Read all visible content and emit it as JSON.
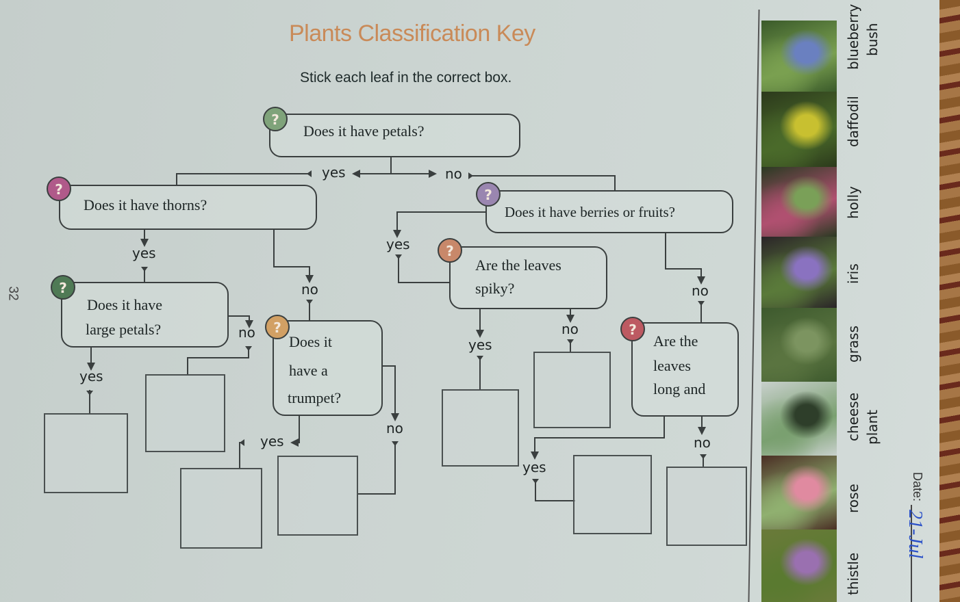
{
  "worksheet": {
    "title": "Plants Classification Key",
    "instruction": "Stick each leaf in the correct box.",
    "page_number": "32",
    "date_label": "Date:",
    "date_value": "21-Jul"
  },
  "colors": {
    "title": "#c98a58",
    "q1_petals": "#7fa37a",
    "q2_thorns": "#b05a8a",
    "q3_large_petals": "#4f7a55",
    "q4_trumpet": "#d2a064",
    "q5_berries": "#9a86b0",
    "q6_spiky": "#c8886a",
    "q7_long": "#bd5a62",
    "date_ink": "#2a50c8"
  },
  "questions": {
    "q1": {
      "mark": "?",
      "text": "Does it have petals?"
    },
    "q2": {
      "mark": "?",
      "text": "Does it have thorns?"
    },
    "q3": {
      "mark": "?",
      "line1": "Does it have",
      "line2": "large petals?"
    },
    "q4": {
      "mark": "?",
      "line1": "Does it",
      "line2": "have a",
      "line3": "trumpet?"
    },
    "q5": {
      "mark": "?",
      "text": "Does it have berries or fruits?"
    },
    "q6": {
      "mark": "?",
      "line1": "Are the leaves",
      "line2": "spiky?"
    },
    "q7": {
      "mark": "?",
      "line1": "Are the",
      "line2": "leaves",
      "line3": "long and"
    }
  },
  "branch_labels": {
    "q1_yes": "yes",
    "q1_no": "no",
    "q2_yes": "yes",
    "q2_no": "no",
    "q3_yes": "yes",
    "q3_no": "no",
    "q4_yes": "yes",
    "q4_no": "no",
    "q5_yes": "yes",
    "q5_no": "no",
    "q6_yes": "yes",
    "q6_no": "no",
    "q7_yes": "yes",
    "q7_no": "no"
  },
  "answer_boxes": [
    {
      "id": "large-petals-yes"
    },
    {
      "id": "large-petals-no"
    },
    {
      "id": "trumpet-yes"
    },
    {
      "id": "trumpet-no"
    },
    {
      "id": "spiky-yes"
    },
    {
      "id": "spiky-no"
    },
    {
      "id": "long-yes"
    },
    {
      "id": "long-no"
    }
  ],
  "plants": [
    {
      "name": "blueberry",
      "name2": "bush",
      "photo_colors": [
        "#3a5a2a",
        "#6a80c0",
        "#7aa050"
      ]
    },
    {
      "name": "daffodil",
      "photo_colors": [
        "#2c3a1c",
        "#c8c030",
        "#4a6a2a"
      ]
    },
    {
      "name": "holly",
      "photo_colors": [
        "#2a3a22",
        "#7aa058",
        "#b05070"
      ]
    },
    {
      "name": "iris",
      "photo_colors": [
        "#2a2428",
        "#8a72c0",
        "#5a7a3a"
      ]
    },
    {
      "name": "grass",
      "photo_colors": [
        "#3e5a2e",
        "#7c9460",
        "#5a7440"
      ]
    },
    {
      "name": "cheese",
      "name2": "plant",
      "photo_colors": [
        "#c8d0cc",
        "#2e3e2a",
        "#7aa070"
      ]
    },
    {
      "name": "rose",
      "photo_colors": [
        "#4a2e24",
        "#e08aa0",
        "#90b070"
      ]
    },
    {
      "name": "thistle",
      "photo_colors": [
        "#6a7a3a",
        "#9a70b0",
        "#5a7a30"
      ]
    }
  ]
}
